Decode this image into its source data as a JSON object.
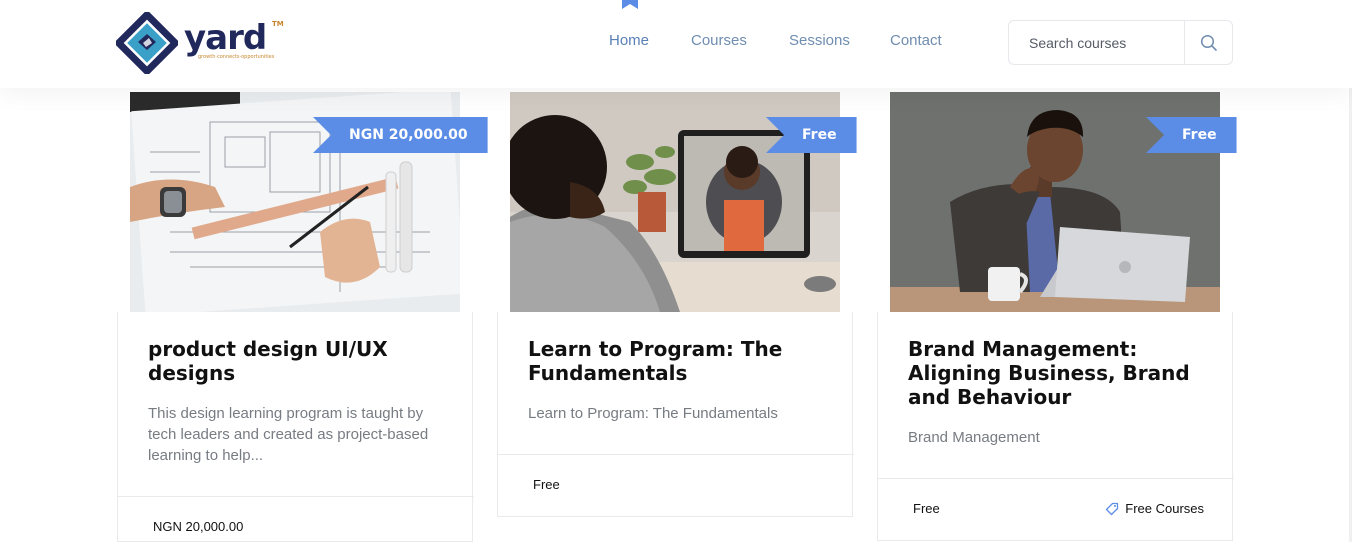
{
  "brand": {
    "name": "yard",
    "trademark": "TM",
    "tagline": "growth·connects·opportunities"
  },
  "nav": {
    "items": [
      {
        "label": "Home",
        "active": true
      },
      {
        "label": "Courses",
        "active": false
      },
      {
        "label": "Sessions",
        "active": false
      },
      {
        "label": "Contact",
        "active": false
      }
    ]
  },
  "search": {
    "placeholder": "Search courses",
    "icon": "search-icon"
  },
  "colors": {
    "accent": "#5b8de6",
    "nav_text": "#6f8db0",
    "brand_navy": "#21285c",
    "brand_gold": "#c8872e"
  },
  "courses": [
    {
      "price_tag": "NGN 20,000.00",
      "image": "hands-drawing-architectural-blueprint",
      "title": "product design UI/UX designs",
      "description": "This design learning program is taught by tech leaders and created as project-based learning to help...",
      "footer_price": "NGN 20,000.00"
    },
    {
      "price_tag": "Free",
      "image": "child-on-video-call-with-teacher",
      "title": "Learn to Program: The Fundamentals",
      "description": "Learn to Program: The Fundamentals",
      "footer_price": "Free"
    },
    {
      "price_tag": "Free",
      "image": "man-in-blazer-using-laptop",
      "title": "Brand Management: Aligning Business, Brand and Behaviour",
      "description": "Brand Management",
      "footer_price": "Free",
      "category": "Free Courses",
      "category_icon": "tag-icon"
    }
  ]
}
